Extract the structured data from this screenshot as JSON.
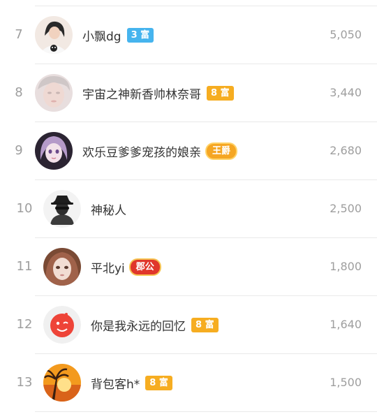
{
  "rows": [
    {
      "rank": "7",
      "name": "小飘dg",
      "badge": "3 富",
      "badge_color": "#46b4ee",
      "score": "5,050",
      "avatar": "girl-panda-shirt"
    },
    {
      "rank": "8",
      "name": "宇宙之神新香帅林奈哥",
      "badge": "8 富",
      "badge_color": "#f6ad21",
      "score": "3,440",
      "avatar": "blurred-face"
    },
    {
      "rank": "9",
      "name": "欢乐豆爹爹宠孩的娘亲",
      "badge": "王爵",
      "badge_color": "#f5a623",
      "score": "2,680",
      "avatar": "anime-purple-hair"
    },
    {
      "rank": "10",
      "name": "神秘人",
      "badge": "",
      "badge_color": "",
      "score": "2,500",
      "avatar": "mystery-man"
    },
    {
      "rank": "11",
      "name": "平北yi",
      "badge": "郡公",
      "badge_color": "#e0362b",
      "score": "1,800",
      "avatar": "doll-face"
    },
    {
      "rank": "12",
      "name": "你是我永远的回忆",
      "badge": "8 富",
      "badge_color": "#f6ad21",
      "score": "1,640",
      "avatar": "red-wink-smiley"
    },
    {
      "rank": "13",
      "name": "背包客h*",
      "badge": "8 富",
      "badge_color": "#f6ad21",
      "score": "1,500",
      "avatar": "sunset"
    }
  ]
}
